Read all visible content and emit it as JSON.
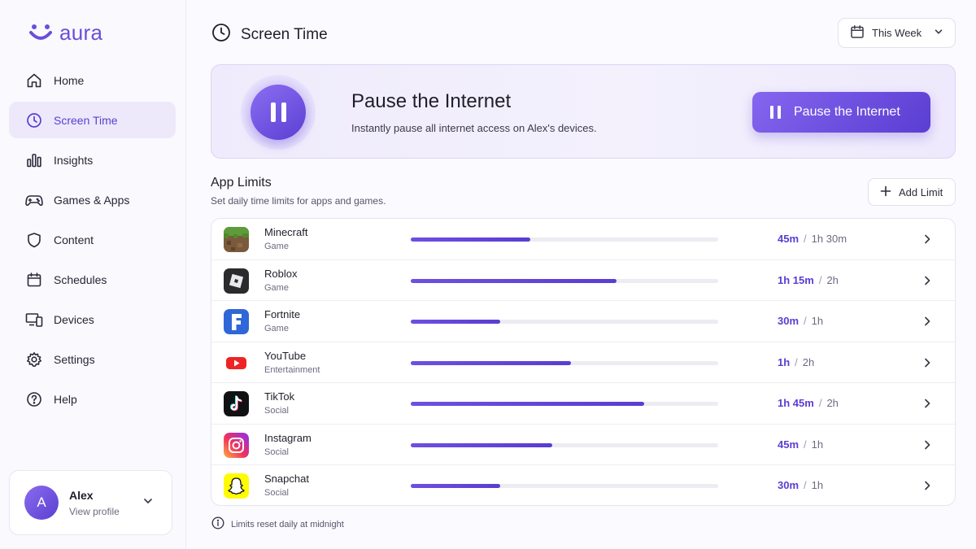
{
  "brand": {
    "name": "aura",
    "color": "#6b4fd8"
  },
  "sidebar": {
    "items": [
      {
        "label": "Home",
        "icon": "home-icon",
        "active": false
      },
      {
        "label": "Screen Time",
        "icon": "clock-icon",
        "active": true
      },
      {
        "label": "Insights",
        "icon": "bar-chart-icon",
        "active": false
      },
      {
        "label": "Games & Apps",
        "icon": "gamepad-icon",
        "active": false
      },
      {
        "label": "Content",
        "icon": "shield-icon",
        "active": false
      },
      {
        "label": "Schedules",
        "icon": "calendar-icon",
        "active": false
      },
      {
        "label": "Devices",
        "icon": "devices-icon",
        "active": false
      },
      {
        "label": "Settings",
        "icon": "gear-icon",
        "active": false
      },
      {
        "label": "Help",
        "icon": "help-icon",
        "active": false
      }
    ],
    "profile": {
      "initial": "A",
      "name": "Alex",
      "link": "View profile"
    }
  },
  "header": {
    "title": "Screen Time",
    "range": "This Week"
  },
  "pause": {
    "title": "Pause the Internet",
    "subtitle": "Instantly pause all internet access on Alex's devices.",
    "button_label": "Pause the Internet"
  },
  "app_limits": {
    "title": "App Limits",
    "subtitle": "Set daily time limits for apps and games.",
    "add_label": "Add Limit",
    "rows": [
      {
        "name": "Minecraft",
        "category": "Game",
        "used": "45m",
        "limit": "1h 30m",
        "progress": 0.39,
        "icon": "minecraft-icon"
      },
      {
        "name": "Roblox",
        "category": "Game",
        "used": "1h 15m",
        "limit": "2h",
        "progress": 0.67,
        "icon": "roblox-icon"
      },
      {
        "name": "Fortnite",
        "category": "Game",
        "used": "30m",
        "limit": "1h",
        "progress": 0.29,
        "icon": "fortnite-icon"
      },
      {
        "name": "YouTube",
        "category": "Entertainment",
        "used": "1h",
        "limit": "2h",
        "progress": 0.52,
        "icon": "youtube-icon"
      },
      {
        "name": "TikTok",
        "category": "Social",
        "used": "1h 45m",
        "limit": "2h",
        "progress": 0.76,
        "icon": "tiktok-icon"
      },
      {
        "name": "Instagram",
        "category": "Social",
        "used": "45m",
        "limit": "1h",
        "progress": 0.46,
        "icon": "instagram-icon"
      },
      {
        "name": "Snapchat",
        "category": "Social",
        "used": "30m",
        "limit": "1h",
        "progress": 0.29,
        "icon": "snapchat-icon"
      }
    ],
    "footnote": "Limits reset daily at midnight"
  },
  "colors": {
    "accent": "#5a3dd2",
    "accent_light": "#ede9fb"
  }
}
